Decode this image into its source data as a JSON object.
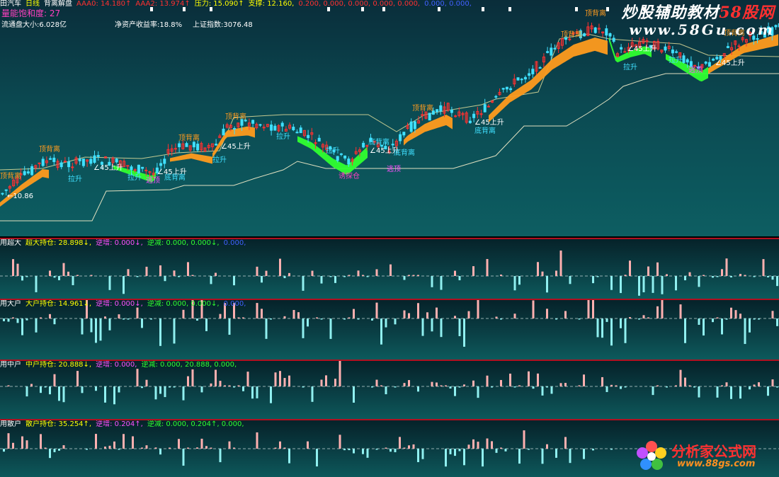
{
  "main_panel": {
    "header": [
      {
        "text": "田汽车",
        "color": "white"
      },
      {
        "text": "日线",
        "color": "yellow"
      },
      {
        "text": "背离解盘",
        "color": "white"
      },
      {
        "text": "AAA0: 14.180↑",
        "color": "red"
      },
      {
        "text": "AAA2: 13.974↑",
        "color": "red"
      },
      {
        "text": "压力: 15.090↑",
        "color": "yellow"
      },
      {
        "text": "支撑: 12.160,",
        "color": "yellow"
      },
      {
        "text": "0.200, 0.000, 0.000, 0.000, 0.000,",
        "color": "red"
      },
      {
        "text": "0.000, 0.000,",
        "color": "blue"
      }
    ],
    "energy_label": "量能饱和度: 27",
    "float_cap": "流通盘大小:6.028亿",
    "roe": "净资产收益率:18.8%",
    "index": "上证指数:3076.48",
    "low_price": "←10.86",
    "signals": [
      {
        "text": "顶背离",
        "type": "top"
      },
      {
        "text": "顶背离",
        "type": "top"
      },
      {
        "text": "顶背离",
        "type": "top"
      },
      {
        "text": "顶背离",
        "type": "top"
      },
      {
        "text": "顶背离",
        "type": "top"
      },
      {
        "text": "顶背离",
        "type": "top"
      },
      {
        "text": "顶背离",
        "type": "top"
      },
      {
        "text": "顶背离",
        "type": "top"
      },
      {
        "text": "拉升",
        "type": "pull"
      },
      {
        "text": "拉升",
        "type": "pull"
      },
      {
        "text": "拉升",
        "type": "pull"
      },
      {
        "text": "拉升",
        "type": "pull"
      },
      {
        "text": "拉升",
        "type": "pull"
      },
      {
        "text": "拉升",
        "type": "pull"
      },
      {
        "text": "拉升",
        "type": "pull"
      },
      {
        "text": "∠45上升",
        "type": "rise"
      },
      {
        "text": "∠45上升",
        "type": "rise"
      },
      {
        "text": "∠45上升",
        "type": "rise"
      },
      {
        "text": "∠45上升",
        "type": "rise"
      },
      {
        "text": "∠45上升",
        "type": "rise"
      },
      {
        "text": "∠45上升",
        "type": "rise"
      },
      {
        "text": "∠45上升",
        "type": "rise"
      },
      {
        "text": "底背离",
        "type": "bottom"
      },
      {
        "text": "底背离",
        "type": "bottom"
      },
      {
        "text": "底背离",
        "type": "bottom"
      },
      {
        "text": "底背离",
        "type": "bottom"
      },
      {
        "text": "逃顶",
        "type": "escape"
      },
      {
        "text": "逃顶",
        "type": "escape"
      },
      {
        "text": "逃顶",
        "type": "escape"
      },
      {
        "text": "诱探仓",
        "type": "trap"
      }
    ]
  },
  "sub_panels": [
    {
      "name": "用超大",
      "hold": "超大持仓: 28.898↓,",
      "trend_up": "逆增: 0.000↓,",
      "trend_down": "逆减: 0.000, 0.000↓,",
      "extra": "0.000,"
    },
    {
      "name": "用大户",
      "hold": "大户持仓: 14.961↓,",
      "trend_up": "逆增: 0.000↓,",
      "trend_down": "逆减: 0.000, 0.000↓,",
      "extra": "0.000,"
    },
    {
      "name": "用中户",
      "hold": "中户持仓: 20.888↓,",
      "trend_up": "逆增: 0.000,",
      "trend_down": "逆减: 0.000, 20.888, 0.000,",
      "extra": ""
    },
    {
      "name": "用散户",
      "hold": "散户持仓: 35.254↑,",
      "trend_up": "逆增: 0.204↑,",
      "trend_down": "逆减: 0.000, 0.204↑, 0.000,",
      "extra": ""
    }
  ],
  "watermark": {
    "line1_a": "炒股辅助教材",
    "line1_b": "58股网",
    "line2": "www.58Gu.com"
  },
  "logo": {
    "title": "分析家公式网",
    "url": "www.88gs.com"
  },
  "colors": {
    "up": "#ff3030",
    "down": "#40e0ff",
    "orange_band": "#ff9b1e",
    "green_band": "#30ff30",
    "support": "#e0e0c0",
    "resistance": "#f0e8a0",
    "pos_bar": "#ffb0b0",
    "neg_bar": "#90f0f0"
  }
}
